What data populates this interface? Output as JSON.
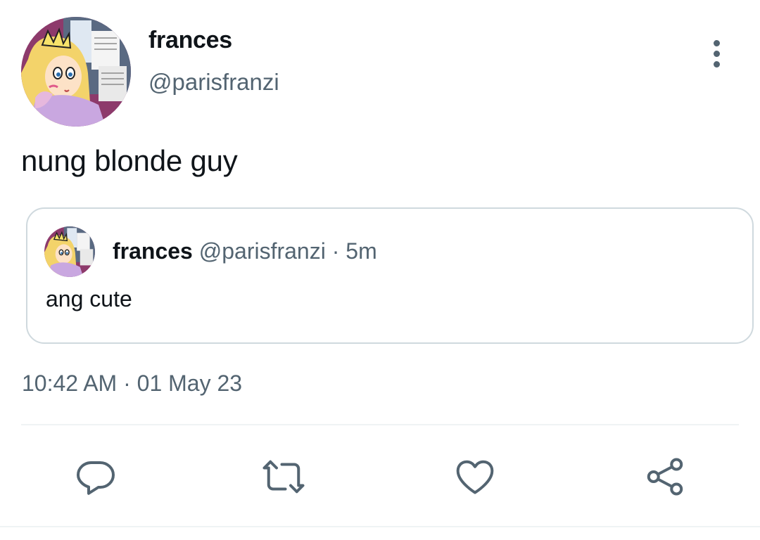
{
  "tweet": {
    "author_name": "frances",
    "author_handle": "@parisfranzi",
    "text": "nung blonde guy",
    "time": "10:42 AM",
    "separator": " · ",
    "date": "01 May 23"
  },
  "quoted_tweet": {
    "author_name": "frances",
    "author_handle": "@parisfranzi",
    "separator": "·",
    "age": "5m",
    "text": "ang cute"
  },
  "actions": [
    {
      "icon": "reply-icon"
    },
    {
      "icon": "retweet-icon"
    },
    {
      "icon": "like-icon"
    },
    {
      "icon": "share-icon"
    }
  ],
  "colors": {
    "text_primary": "#0f1419",
    "text_secondary": "#536471",
    "border": "#cfd9de",
    "divider": "#eff3f4",
    "icon": "#536471"
  }
}
